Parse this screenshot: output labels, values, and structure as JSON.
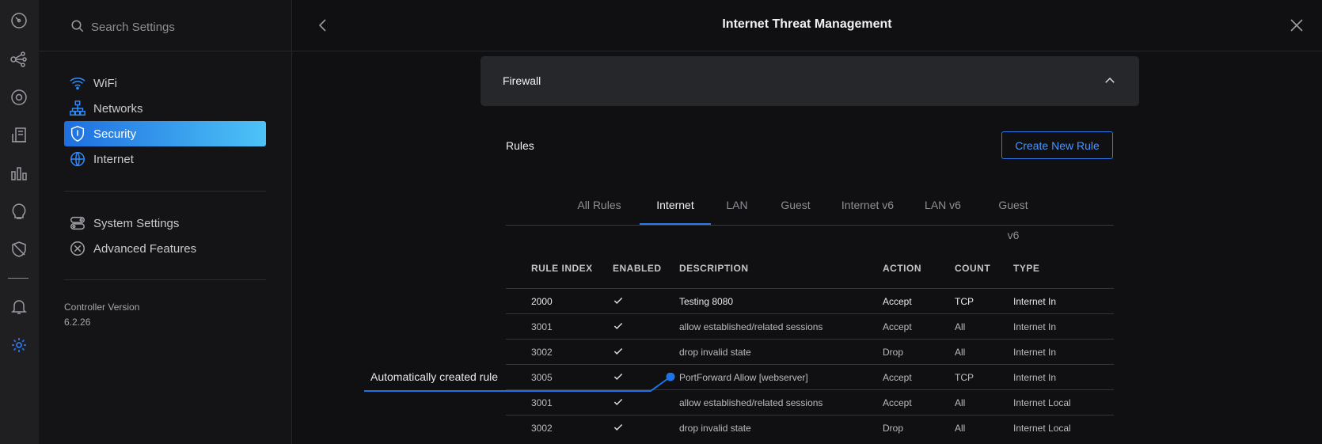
{
  "rail": {
    "icons": [
      "dashboard-icon",
      "topology-icon",
      "devices-icon",
      "clients-icon",
      "statistics-icon",
      "insights-icon",
      "threat-icon",
      "notifications-icon",
      "settings-icon"
    ]
  },
  "sidebar": {
    "search_placeholder": "Search Settings",
    "items": [
      {
        "label": "WiFi",
        "icon": "wifi-icon"
      },
      {
        "label": "Networks",
        "icon": "networks-icon"
      },
      {
        "label": "Security",
        "icon": "security-shield-icon",
        "active": true
      },
      {
        "label": "Internet",
        "icon": "globe-icon"
      },
      {
        "label": "System Settings",
        "icon": "system-settings-icon"
      },
      {
        "label": "Advanced Features",
        "icon": "advanced-features-icon"
      }
    ],
    "controller_version_label": "Controller Version",
    "controller_version": "6.2.26"
  },
  "header": {
    "title": "Internet Threat Management"
  },
  "firewall": {
    "title": "Firewall"
  },
  "rules": {
    "title": "Rules",
    "create_label": "Create New Rule",
    "tabs": [
      "All Rules",
      "Internet",
      "LAN",
      "Guest",
      "Internet v6",
      "LAN v6",
      "Guest v6"
    ],
    "active_tab": "Internet",
    "columns": [
      "RULE INDEX",
      "ENABLED",
      "DESCRIPTION",
      "ACTION",
      "COUNT",
      "TYPE"
    ],
    "rows": [
      {
        "index": "2000",
        "enabled": true,
        "description": "Testing 8080",
        "action": "Accept",
        "count": "TCP",
        "type": "Internet In"
      },
      {
        "index": "3001",
        "enabled": true,
        "description": "allow established/related sessions",
        "action": "Accept",
        "count": "All",
        "type": "Internet In"
      },
      {
        "index": "3002",
        "enabled": true,
        "description": "drop invalid state",
        "action": "Drop",
        "count": "All",
        "type": "Internet In"
      },
      {
        "index": "3005",
        "enabled": true,
        "description": "PortForward Allow [webserver]",
        "action": "Accept",
        "count": "TCP",
        "type": "Internet In"
      },
      {
        "index": "3001",
        "enabled": true,
        "description": "allow established/related sessions",
        "action": "Accept",
        "count": "All",
        "type": "Internet Local"
      },
      {
        "index": "3002",
        "enabled": true,
        "description": "drop invalid state",
        "action": "Drop",
        "count": "All",
        "type": "Internet Local"
      }
    ]
  },
  "annotation": {
    "text": "Automatically created rule"
  },
  "colors": {
    "accent": "#2f78e8",
    "annotation": "#1e74e6",
    "active_gradient_start": "#1e6fe0",
    "active_gradient_end": "#4dc3f7"
  }
}
